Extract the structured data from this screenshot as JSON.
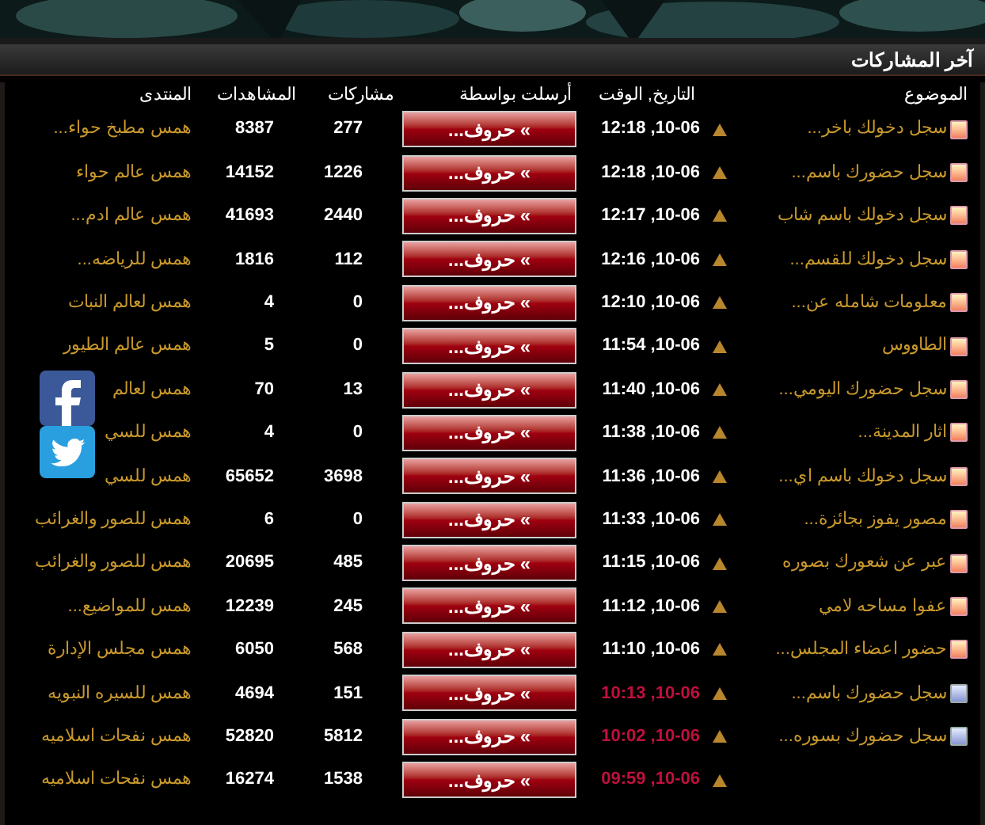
{
  "section": {
    "title": "آخر المشاركات"
  },
  "columns": {
    "topic": "الموضوع",
    "date": "التاريخ, الوقت",
    "author": "أرسلت بواسطة",
    "posts": "مشاركات",
    "views": "المشاهدات",
    "forum": "المنتدى"
  },
  "rows": [
    {
      "topic": "سجل دخولك باخر...",
      "read": false,
      "date": "10-06, 12:18",
      "old": false,
      "author": "» حروف...",
      "posts": "277",
      "views": "8387",
      "forum": "همس مطبخ حواء..."
    },
    {
      "topic": "سجل حضورك باسم...",
      "read": false,
      "date": "10-06, 12:18",
      "old": false,
      "author": "» حروف...",
      "posts": "1226",
      "views": "14152",
      "forum": "همس عالم حواء"
    },
    {
      "topic": "سجل دخولك باسم شاب",
      "read": false,
      "date": "10-06, 12:17",
      "old": false,
      "author": "» حروف...",
      "posts": "2440",
      "views": "41693",
      "forum": "همس عالم ادم..."
    },
    {
      "topic": "سجل دخولك للقسم...",
      "read": false,
      "date": "10-06, 12:16",
      "old": false,
      "author": "» حروف...",
      "posts": "112",
      "views": "1816",
      "forum": "همس للرياضه..."
    },
    {
      "topic": "معلومات شامله عن...",
      "read": false,
      "date": "10-06, 12:10",
      "old": false,
      "author": "» حروف...",
      "posts": "0",
      "views": "4",
      "forum": "همس لعالم النبات"
    },
    {
      "topic": "الطاووس",
      "read": false,
      "date": "10-06, 11:54",
      "old": false,
      "author": "» حروف...",
      "posts": "0",
      "views": "5",
      "forum": "همس عالم الطيور"
    },
    {
      "topic": "سجل حضورك اليومي...",
      "read": false,
      "date": "10-06, 11:40",
      "old": false,
      "author": "» حروف...",
      "posts": "13",
      "views": "70",
      "forum": "همس لعالم"
    },
    {
      "topic": "اثار المدينة...",
      "read": false,
      "date": "10-06, 11:38",
      "old": false,
      "author": "» حروف...",
      "posts": "0",
      "views": "4",
      "forum": "همس للسي"
    },
    {
      "topic": "سجل دخولك باسم اي...",
      "read": false,
      "date": "10-06, 11:36",
      "old": false,
      "author": "» حروف...",
      "posts": "3698",
      "views": "65652",
      "forum": "همس للسي"
    },
    {
      "topic": "مصور يفوز بجائزة...",
      "read": false,
      "date": "10-06, 11:33",
      "old": false,
      "author": "» حروف...",
      "posts": "0",
      "views": "6",
      "forum": "همس للصور والغرائب"
    },
    {
      "topic": "عبر عن شعورك بصوره",
      "read": false,
      "date": "10-06, 11:15",
      "old": false,
      "author": "» حروف...",
      "posts": "485",
      "views": "20695",
      "forum": "همس للصور والغرائب"
    },
    {
      "topic": "عفوا مساحه لامي",
      "read": false,
      "date": "10-06, 11:12",
      "old": false,
      "author": "» حروف...",
      "posts": "245",
      "views": "12239",
      "forum": "همس للمواضيع..."
    },
    {
      "topic": "حضور اعضاء المجلس...",
      "read": false,
      "date": "10-06, 11:10",
      "old": false,
      "author": "» حروف...",
      "posts": "568",
      "views": "6050",
      "forum": "همس مجلس الإدارة"
    },
    {
      "topic": "سجل حضورك باسم...",
      "read": true,
      "date": "10-06, 10:13",
      "old": true,
      "author": "» حروف...",
      "posts": "151",
      "views": "4694",
      "forum": "همس للسيره النبويه"
    },
    {
      "topic": "سجل حضورك بسوره...",
      "read": true,
      "date": "10-06, 10:02",
      "old": true,
      "author": "» حروف...",
      "posts": "5812",
      "views": "52820",
      "forum": "همس نفحات اسلاميه"
    },
    {
      "date": "10-06, 09:59",
      "old": true,
      "author": "» حروف...",
      "posts": "1538",
      "views": "16274",
      "forum": "همس نفحات اسلاميه"
    }
  ]
}
